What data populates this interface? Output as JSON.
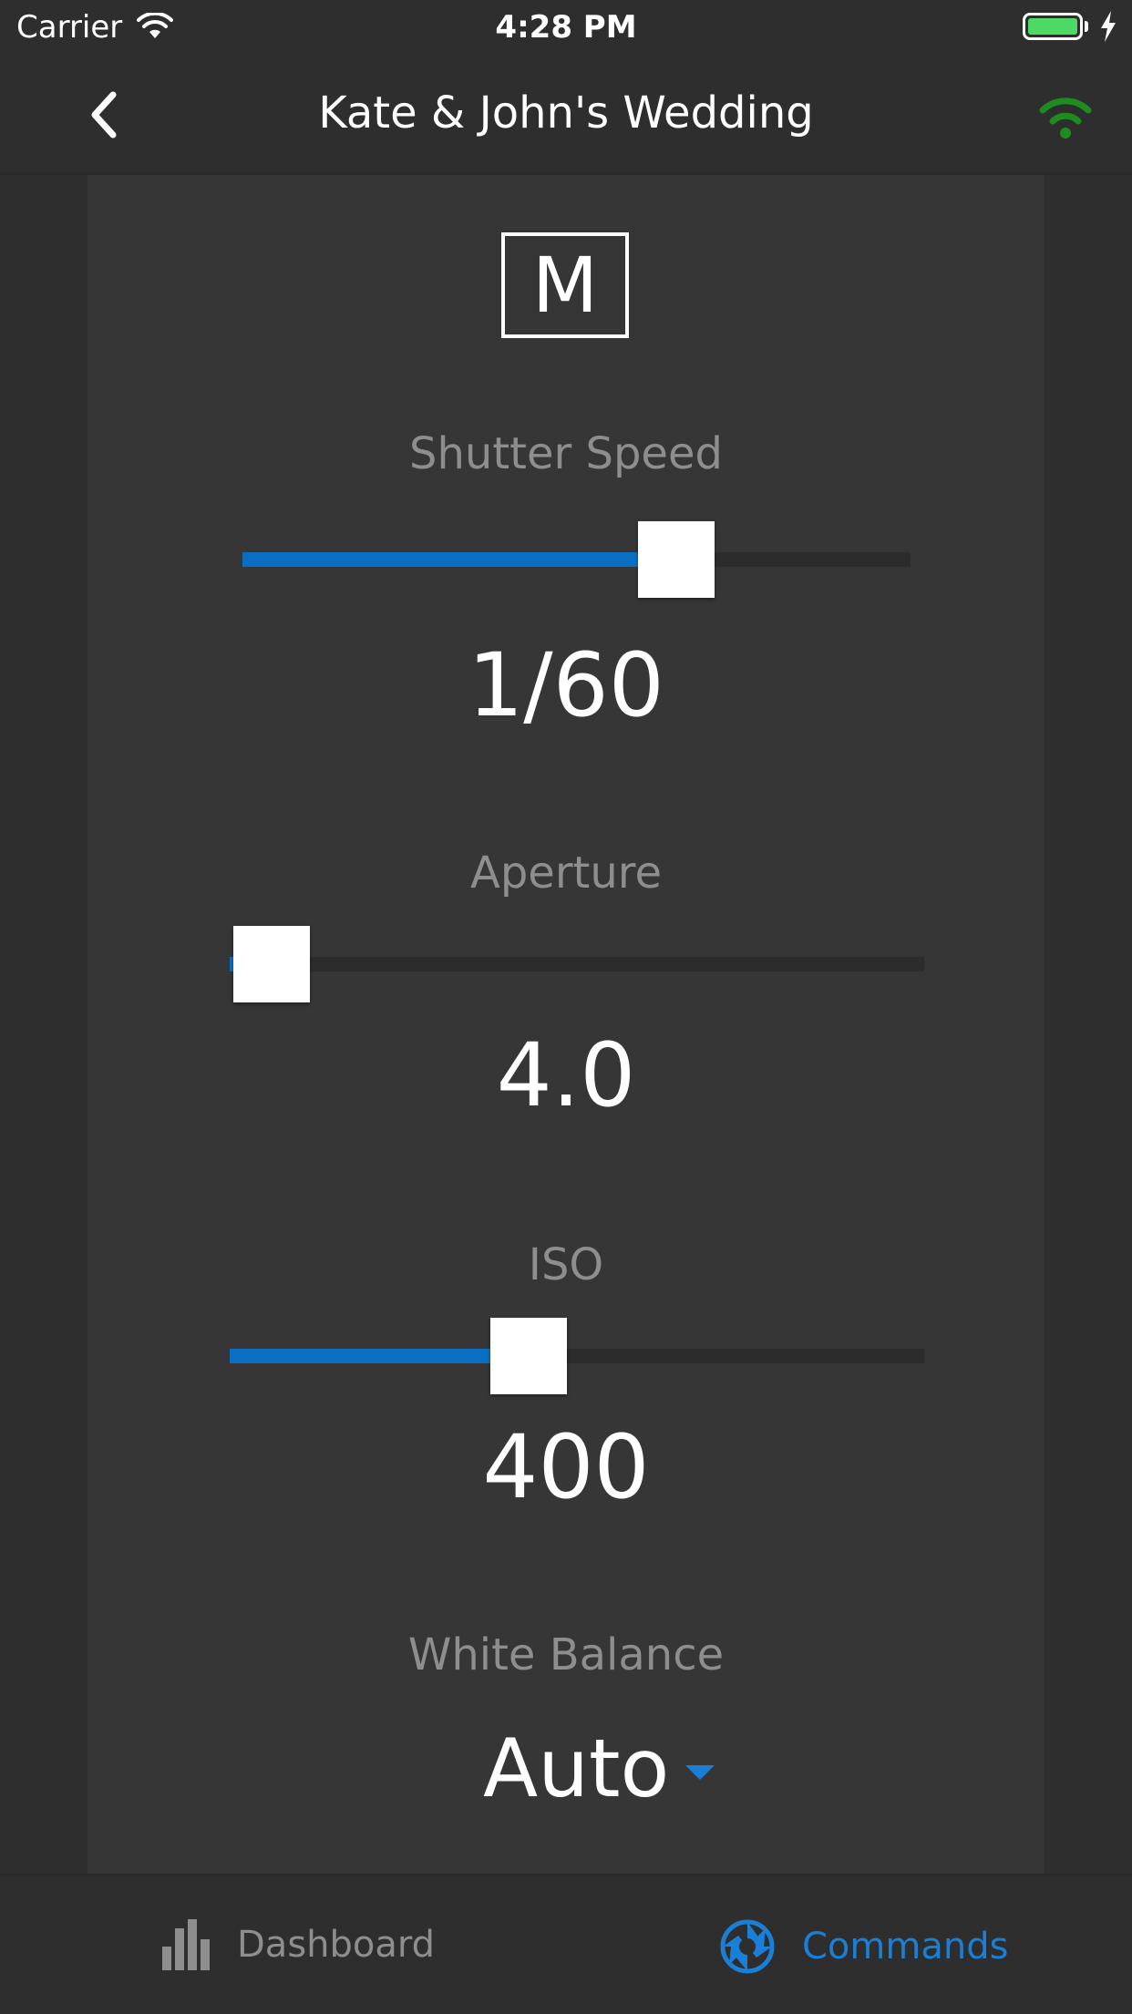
{
  "status_bar": {
    "carrier": "Carrier",
    "time": "4:28 PM",
    "battery_color": "#4cd964"
  },
  "nav": {
    "title": "Kate & John's Wedding",
    "back_icon": "chevron-left-icon",
    "connection_icon": "wifi-icon",
    "connection_color": "#1e8c1e"
  },
  "mode": {
    "label": "M"
  },
  "controls": {
    "shutter_speed": {
      "label": "Shutter Speed",
      "value": "1/60",
      "position": 0.65
    },
    "aperture": {
      "label": "Aperture",
      "value": "4.0",
      "position": 0.06
    },
    "iso": {
      "label": "ISO",
      "value": "400",
      "position": 0.43
    },
    "white_balance": {
      "label": "White Balance",
      "value": "Auto"
    }
  },
  "tabs": {
    "dashboard": {
      "label": "Dashboard",
      "icon": "bar-chart-icon",
      "active": false
    },
    "commands": {
      "label": "Commands",
      "icon": "aperture-icon",
      "active": true
    }
  },
  "colors": {
    "accent": "#1a7fd6",
    "slider_fill": "#0a6fc2",
    "background": "#2e2e2e",
    "panel": "#363636",
    "muted_text": "#8e8e8e"
  }
}
